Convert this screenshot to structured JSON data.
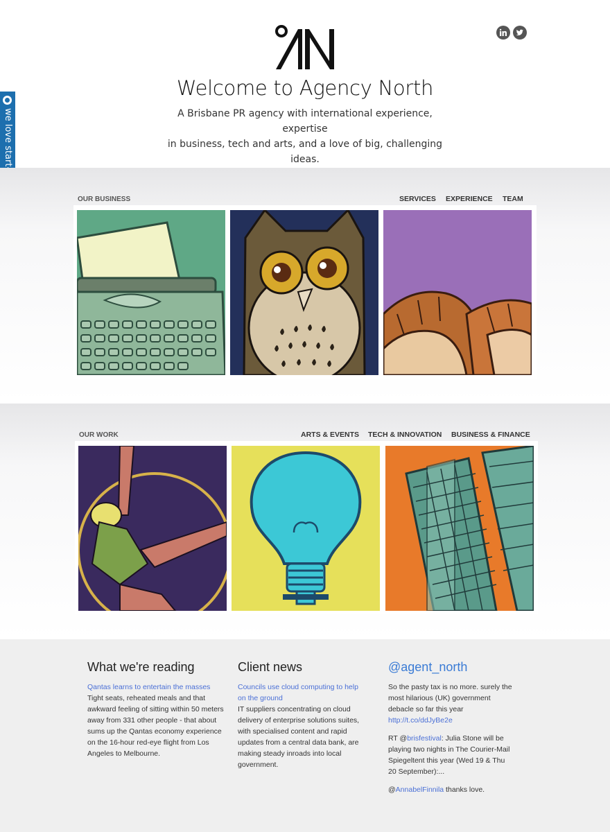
{
  "header": {
    "title": "Welcome to Agency North",
    "tagline_line1": "A Brisbane PR agency with international experience, expertise",
    "tagline_line2": "in business, tech and arts, and a love of big, challenging ideas."
  },
  "side_tab": {
    "label": "we love start-ups"
  },
  "social": {
    "linkedin": "in",
    "twitter": "t"
  },
  "business": {
    "label": "OUR BUSINESS",
    "nav": [
      "SERVICES",
      "EXPERIENCE",
      "TEAM"
    ]
  },
  "work": {
    "label": "OUR WORK",
    "nav": [
      "ARTS & EVENTS",
      "TECH & INNOVATION",
      "BUSINESS & FINANCE"
    ]
  },
  "reading": {
    "heading": "What we're reading",
    "link": "Qantas learns to entertain the masses",
    "body": "Tight seats, reheated meals and that awkward feeling of sitting within 50 meters away from 331 other people - that about sums up the Qantas economy experience on the 16-hour red-eye flight from Los Angeles to Melbourne."
  },
  "news": {
    "heading": "Client news",
    "link": "Councils use cloud computing to help on the ground",
    "body": "IT suppliers concentrating on cloud delivery of enterprise solutions suites, with specialised content and rapid updates from a central data bank, are making steady inroads into local government."
  },
  "twitter": {
    "heading": "@agent_north",
    "t1_text": "So the pasty tax is no more. surely the most hilarious (UK) government debacle so far this year ",
    "t1_link": "http://t.co/ddJyBe2e",
    "t2_pre": "RT @",
    "t2_user": "brisfestival",
    "t2_text": ": Julia Stone will be playing two nights in The Courier-Mail Spiegeltent this year (Wed 19 & Thu 20 September):...",
    "t3_pre": "@",
    "t3_user": "AnnabelFinnila",
    "t3_text": " thanks love."
  },
  "colors": {
    "accent": "#1d6fae",
    "link": "#4a6fd6",
    "footer_bg": "#efefef"
  }
}
